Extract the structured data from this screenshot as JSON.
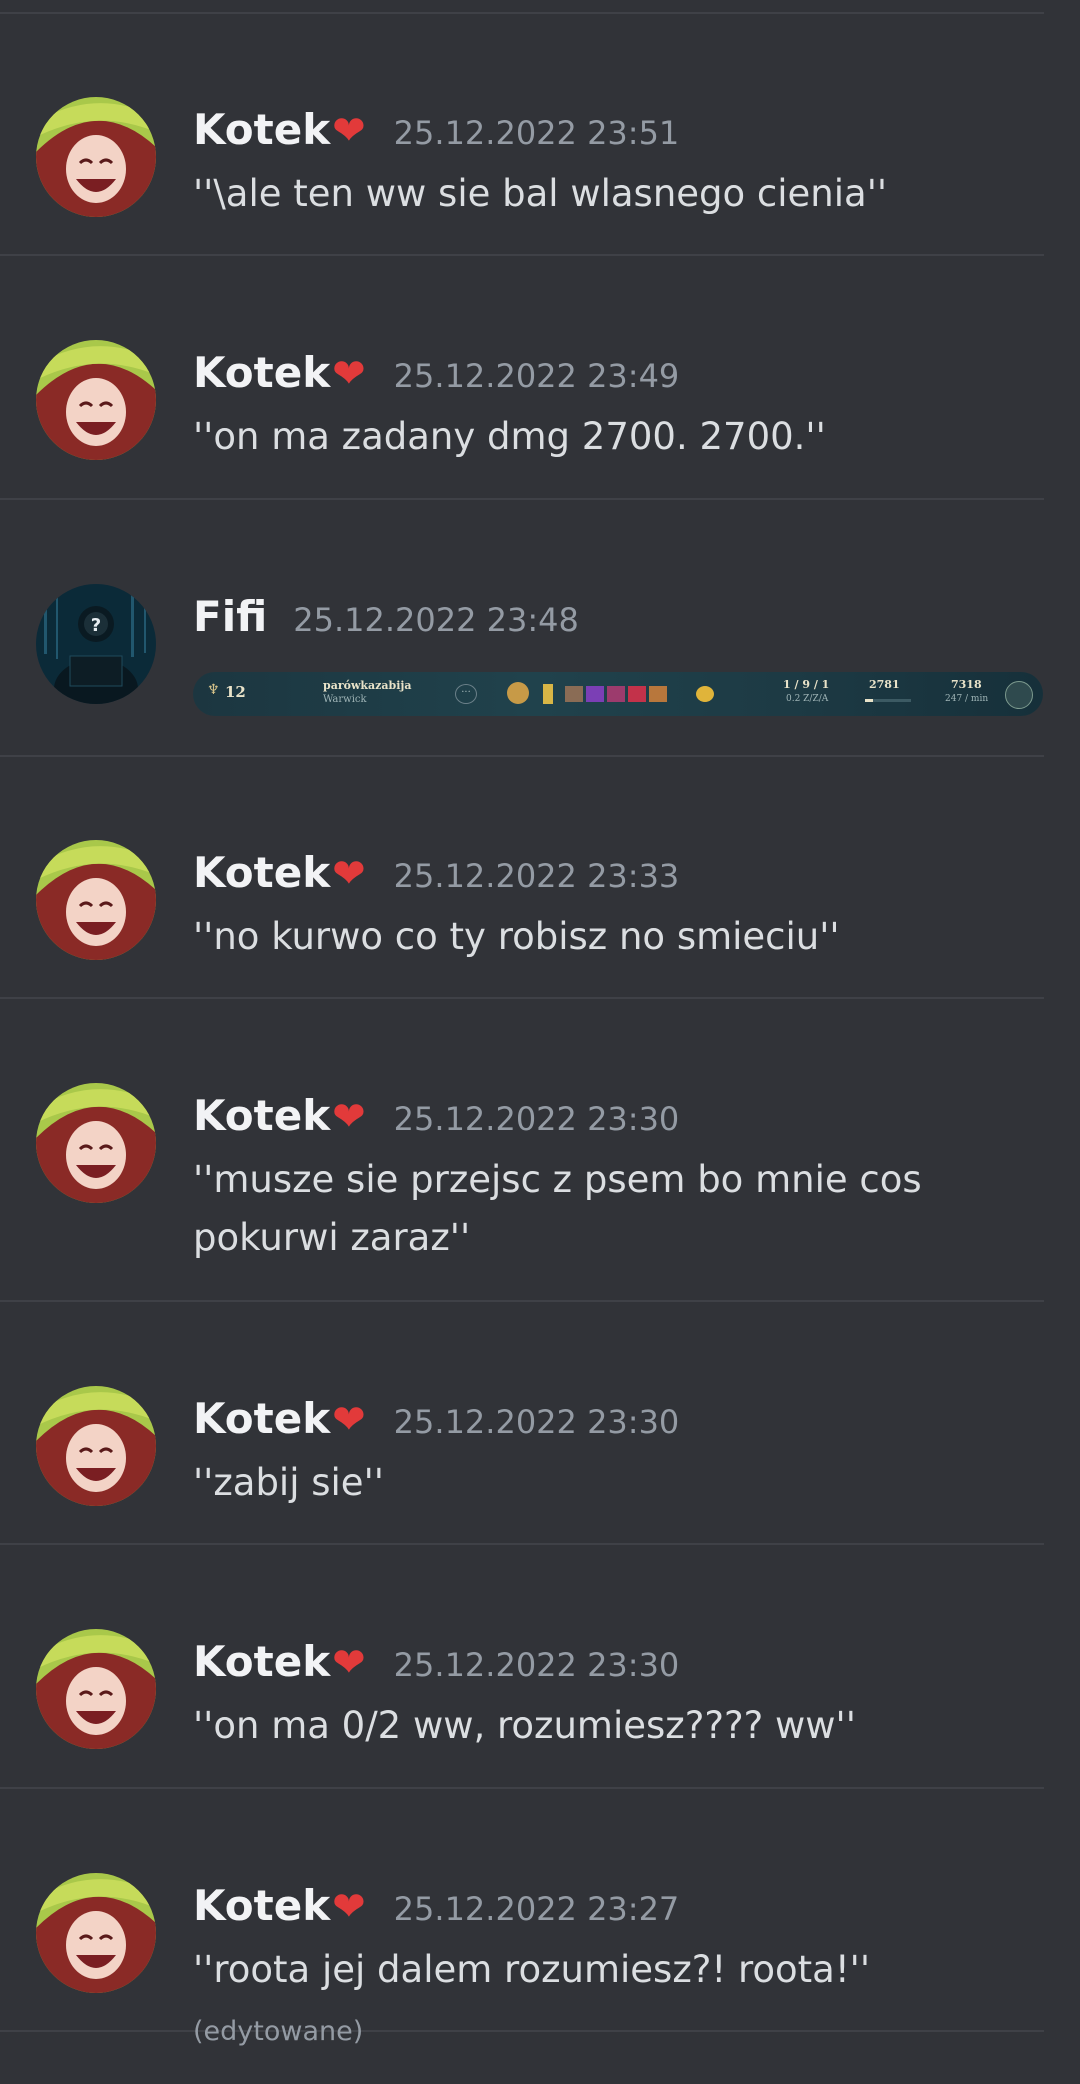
{
  "messages": [
    {
      "author": "Kotek",
      "badge": "❤",
      "timestamp": "25.12.2022 23:51",
      "content": "''\\ale ten ww sie bal wlasnego cienia''"
    },
    {
      "author": "Kotek",
      "badge": "❤",
      "timestamp": "25.12.2022 23:49",
      "content": "''on ma zadany dmg 2700. 2700.''"
    },
    {
      "author": "Fifi",
      "timestamp": "25.12.2022 23:48",
      "embed": {
        "level": "12",
        "summoner": "parówkazabija",
        "champion": "Warwick",
        "kda": "1 / 9 / 1",
        "kda_sub": "0.2 Z/Z/A",
        "damage": "2781",
        "gold": "7318",
        "gold_sub": "247 / min"
      }
    },
    {
      "author": "Kotek",
      "badge": "❤",
      "timestamp": "25.12.2022 23:33",
      "content": "''no kurwo co ty robisz no smieciu''"
    },
    {
      "author": "Kotek",
      "badge": "❤",
      "timestamp": "25.12.2022 23:30",
      "content": "''musze sie przejsc z psem bo mnie cos pokurwi zaraz''"
    },
    {
      "author": "Kotek",
      "badge": "❤",
      "timestamp": "25.12.2022 23:30",
      "content": "''zabij sie''"
    },
    {
      "author": "Kotek",
      "badge": "❤",
      "timestamp": "25.12.2022 23:30",
      "content": "''on ma 0/2 ww, rozumiesz???? ww''"
    },
    {
      "author": "Kotek",
      "badge": "❤",
      "timestamp": "25.12.2022 23:27",
      "content": "''roota jej dalem rozumiesz?! roota!''",
      "edited": "(edytowane)"
    }
  ],
  "colors": {
    "background": "#313338",
    "text": "#dbdee1",
    "muted": "#949ba4",
    "heart": "#e23a3a"
  }
}
